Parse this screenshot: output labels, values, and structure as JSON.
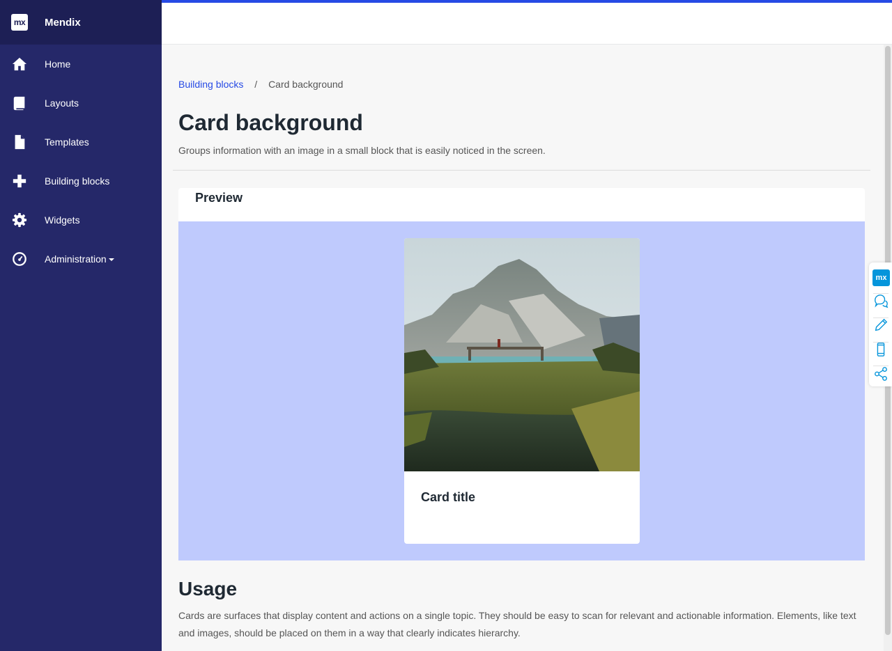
{
  "app": {
    "brand": "Mendix",
    "logo_text": "mx"
  },
  "sidebar": {
    "items": [
      {
        "label": "Home",
        "icon": "home-icon"
      },
      {
        "label": "Layouts",
        "icon": "book-icon"
      },
      {
        "label": "Templates",
        "icon": "file-icon"
      },
      {
        "label": "Building blocks",
        "icon": "plus-icon"
      },
      {
        "label": "Widgets",
        "icon": "gear-icon"
      },
      {
        "label": "Administration",
        "icon": "dashboard-icon"
      }
    ]
  },
  "breadcrumb": {
    "parent": "Building blocks",
    "separator": "/",
    "current": "Card background"
  },
  "page": {
    "title": "Card background",
    "subtitle": "Groups information with an image in a small block that is easily noticed in the screen."
  },
  "preview": {
    "title": "Preview",
    "card_title": "Card title"
  },
  "usage": {
    "title": "Usage",
    "text": "Cards are surfaces that display content and actions on a single topic. They should be easy to scan for relevant and actionable information. Elements, like text and images, should be placed on them in a way that clearly indicates hierarchy."
  },
  "toolbar": {
    "logo_text": "mx",
    "buttons": [
      "feedback-icon",
      "edit-icon",
      "mobile-icon",
      "share-icon"
    ]
  },
  "colors": {
    "sidebar": "#252869",
    "brand_bar": "#1d1f55",
    "accent": "#264ae5",
    "preview_bg": "#bfcafd",
    "toolbar_logo": "#0595db"
  }
}
